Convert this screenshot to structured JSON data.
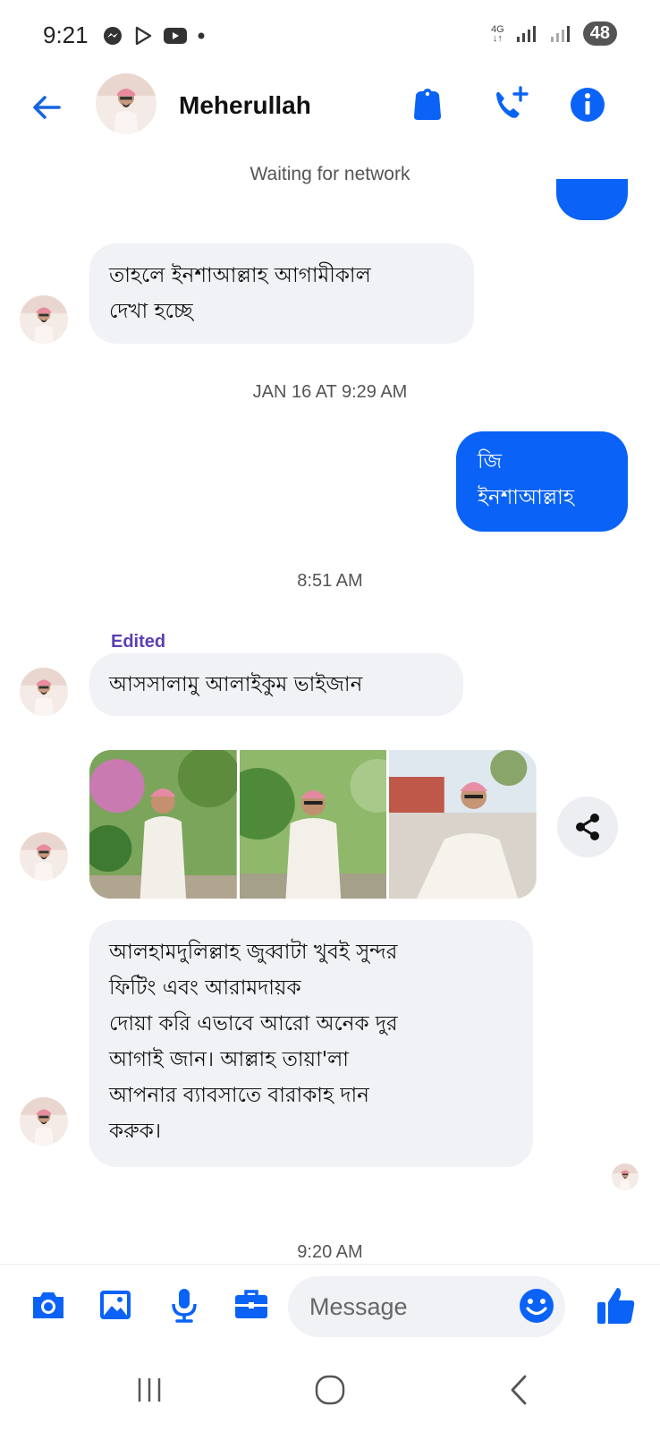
{
  "status_bar": {
    "time": "9:21",
    "network_label": "4G",
    "battery": "48"
  },
  "header": {
    "contact_name": "Meherullah"
  },
  "network_status": "Waiting for network",
  "messages": {
    "in1": [
      "তাহলে ইনশাআল্লাহ আগামীকাল",
      "দেখা হচ্ছে"
    ],
    "ts1": "JAN 16 AT 9:29 AM",
    "out1": [
      "জি",
      "ইনশাআল্লাহ"
    ],
    "ts2": "8:51 AM",
    "edited_label": "Edited",
    "in2": "আসসালামু আলাইকুম ভাইজান",
    "in3": [
      "আলহামদুলিল্লাহ জুব্বাটা খুবই সুন্দর",
      "ফিটিং এবং আরামদায়ক",
      "দোয়া করি এভাবে আরো অনেক দুর",
      "আগাই জান। আল্লাহ তায়া'লা",
      "আপনার ব্যাবসাতে বারাকাহ দান",
      "করুক।"
    ],
    "ts3": "9:20 AM"
  },
  "composer": {
    "placeholder": "Message"
  },
  "colors": {
    "accent": "#0a63f6",
    "incoming_bubble": "#f0f2f5",
    "edited": "#5b3fb4"
  },
  "icons": {
    "back": "arrow-left-icon",
    "tag": "tag-icon",
    "call": "add-call-icon",
    "info": "info-icon",
    "share": "share-icon",
    "camera": "camera-icon",
    "gallery": "image-icon",
    "mic": "mic-icon",
    "toolkit": "briefcase-icon",
    "emoji": "emoji-icon",
    "like": "thumbs-up-icon"
  }
}
